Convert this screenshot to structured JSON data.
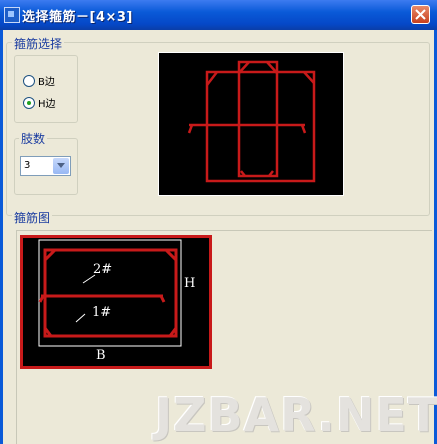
{
  "window": {
    "title": "选择箍筋－[4×3]"
  },
  "stirrup_select": {
    "legend": "箍筋选择",
    "radios": [
      {
        "label": "B边",
        "selected": false
      },
      {
        "label": "H边",
        "selected": true
      }
    ]
  },
  "leg_count": {
    "legend": "肢数",
    "value": "3"
  },
  "diagram": {
    "legend": "箍筋图",
    "labels": {
      "stirrup2": "2#",
      "stirrup1": "1#",
      "height": "H",
      "width": "B"
    }
  },
  "colors": {
    "rebar": "#c81a1a",
    "background": "#000000",
    "outline": "#ffffff",
    "titlebar": "#0a5ad8"
  },
  "watermark": "JZBAR.NET"
}
